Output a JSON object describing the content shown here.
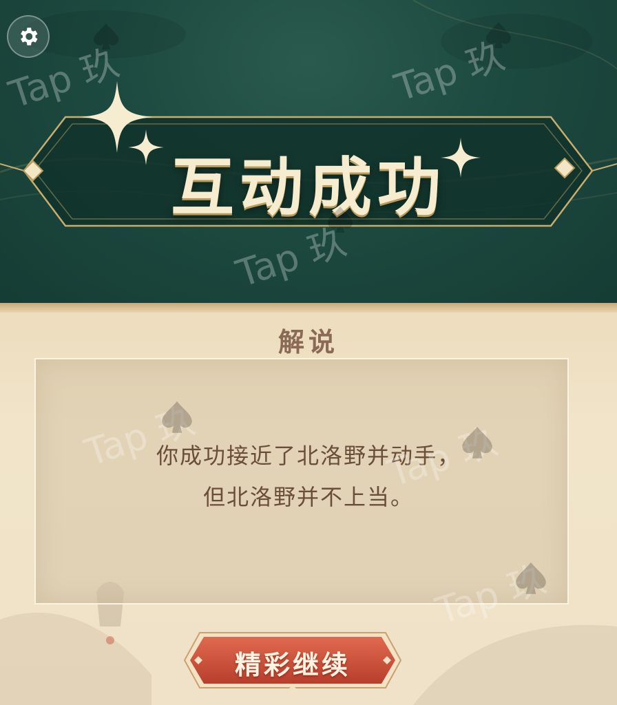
{
  "title": "互动成功",
  "section_title": "解说",
  "narration": {
    "line1": "你成功接近了北洛野并动手，",
    "line2": "但北洛野并不上当。"
  },
  "continue_button": "精彩继续",
  "watermark": "Tap 玖",
  "icons": [
    "gear-icon",
    "sparkle-icon",
    "diamond-icon",
    "spade-icon"
  ],
  "colors": {
    "top_bg": "#1d4a40",
    "gold": "#d8bf84",
    "paper": "#efe2c8",
    "button_red": "#c9503c",
    "text_brown": "#6b4e3a"
  }
}
